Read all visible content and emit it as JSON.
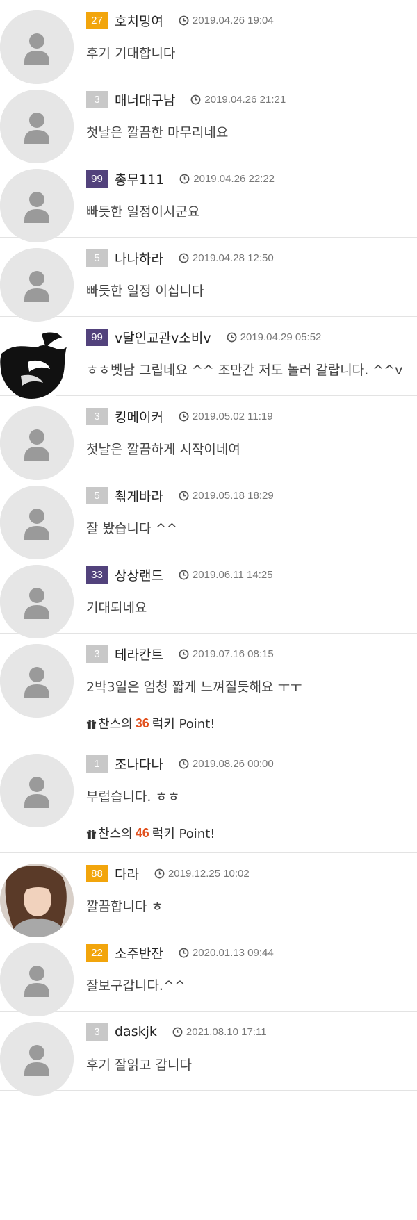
{
  "level_colors": {
    "gold": "#f2a50c",
    "gray": "#c8c8c8",
    "purple": "#52427c"
  },
  "comments": [
    {
      "level": "27",
      "level_color": "gold",
      "nick": "호치밍여",
      "date": "2019.04.26 19:04",
      "text": "후기   기대합니다",
      "avatar": "default"
    },
    {
      "level": "3",
      "level_color": "gray",
      "nick": "매너대구남",
      "date": "2019.04.26 21:21",
      "text": "첫날은 깔끔한 마무리네요",
      "avatar": "default"
    },
    {
      "level": "99",
      "level_color": "purple",
      "nick": "총무111",
      "date": "2019.04.26 22:22",
      "text": "빠듯한 일정이시군요",
      "avatar": "default"
    },
    {
      "level": "5",
      "level_color": "gray",
      "nick": "나나하라",
      "date": "2019.04.28 12:50",
      "text": "빠듯한 일정 이십니다",
      "avatar": "default"
    },
    {
      "level": "99",
      "level_color": "purple",
      "nick": "v달인교관v소비v",
      "date": "2019.04.29 05:52",
      "text": "ㅎㅎ벳남 그립네요 ^^ 조만간 저도 놀러 갈랍니다. ^^v",
      "avatar": "dark"
    },
    {
      "level": "3",
      "level_color": "gray",
      "nick": "킹메이커",
      "date": "2019.05.02 11:19",
      "text": "첫날은 깔끔하게 시작이네여",
      "avatar": "default"
    },
    {
      "level": "5",
      "level_color": "gray",
      "nick": "쵞게바라",
      "date": "2019.05.18 18:29",
      "text": "잘 봤습니다 ^^",
      "avatar": "default"
    },
    {
      "level": "33",
      "level_color": "purple",
      "nick": "상상랜드",
      "date": "2019.06.11 14:25",
      "text": "기대되네요",
      "avatar": "default"
    },
    {
      "level": "3",
      "level_color": "gray",
      "nick": "테라칸트",
      "date": "2019.07.16 08:15",
      "text": "2박3일은 엄청 짧게 느껴질듯해요 ㅜㅜ",
      "avatar": "default",
      "point": {
        "prefix": "찬스의",
        "value": "36",
        "suffix": "럭키 Point!"
      }
    },
    {
      "level": "1",
      "level_color": "gray",
      "nick": "조나다나",
      "date": "2019.08.26 00:00",
      "text": "부럽습니다. ㅎㅎ",
      "avatar": "default",
      "point": {
        "prefix": "찬스의",
        "value": "46",
        "suffix": "럭키 Point!"
      }
    },
    {
      "level": "88",
      "level_color": "gold",
      "nick": "다라",
      "date": "2019.12.25 10:02",
      "text": "깔끔합니다 ㅎ",
      "avatar": "photo"
    },
    {
      "level": "22",
      "level_color": "gold",
      "nick": "소주반잔",
      "date": "2020.01.13 09:44",
      "text": "잘보구갑니다.^^",
      "avatar": "default"
    },
    {
      "level": "3",
      "level_color": "gray",
      "nick": "daskjk",
      "date": "2021.08.10 17:11",
      "text": "후기 잘읽고 갑니다",
      "avatar": "default"
    }
  ]
}
